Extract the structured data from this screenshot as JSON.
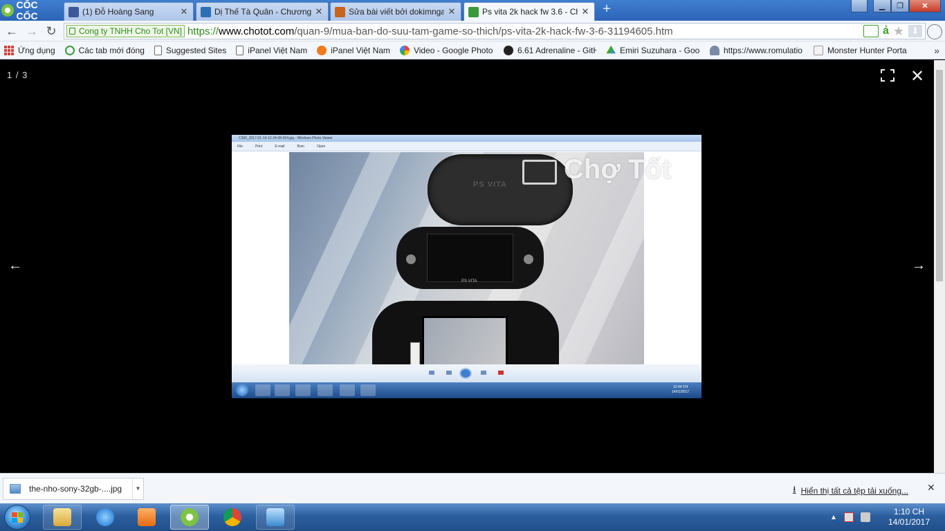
{
  "browser": {
    "brand": "CỐC CỐC",
    "tabs": [
      {
        "label": "(1) Đỗ Hoàng Sang",
        "icon": "facebook-icon",
        "color": "#3b5998"
      },
      {
        "label": "Dị Thế Tà Quân - Chương",
        "icon": "book-icon",
        "color": "#2d6fb5"
      },
      {
        "label": "Sửa bài viết bởi dokimnga",
        "icon": "forum-icon",
        "color": "#c8641e"
      },
      {
        "label": "Ps vita 2k hack fw 3.6 - Ch",
        "icon": "chotot-icon",
        "color": "#3a9a3a"
      }
    ],
    "address": {
      "ev_label": "Cong ty TNHH Cho Tot [VN]",
      "scheme": "https://",
      "host": "www.chotot.com",
      "path": "/quan-9/mua-ban-do-suu-tam-game-so-thich/ps-vita-2k-hack-fw-3-6-31194605.htm"
    },
    "omnibox_a": "ả",
    "bookmarks": [
      {
        "label": "Ứng dụng",
        "icon": "apps-icon"
      },
      {
        "label": "Các tab mới đóng",
        "icon": "recent-tabs-icon"
      },
      {
        "label": "Suggested Sites",
        "icon": "page-icon"
      },
      {
        "label": "iPanel Việt Nam",
        "icon": "page-icon"
      },
      {
        "label": "iPanel Việt Nam",
        "icon": "ipanel-icon"
      },
      {
        "label": "Video - Google Photo",
        "icon": "google-photos-icon"
      },
      {
        "label": "6.61 Adrenaline - GitH",
        "icon": "github-icon"
      },
      {
        "label": "Emiri Suzuhara - Goog",
        "icon": "google-drive-icon"
      },
      {
        "label": "https://www.romulatio",
        "icon": "romulation-icon"
      },
      {
        "label": "Monster Hunter Porta",
        "icon": "ps-icon"
      }
    ]
  },
  "viewer": {
    "counter": "1 / 3",
    "fullscreen_icon": "fullscreen-icon",
    "close_icon": "close-icon",
    "prev_arrow": "←",
    "next_arrow": "→",
    "close_glyph": "✕",
    "photo": {
      "window_title": "C360_2017-01-14-12-24-08-934.jpg - Windows Photo Viewer",
      "menu": [
        "File",
        "Print",
        "E-mail",
        "Burn",
        "Open"
      ],
      "case_logo": "PS VITA",
      "device_logo": "PS VITA",
      "watermark": "Chợ Tốt",
      "inner_clock_time": "12:44 CH",
      "inner_clock_date": "14/01/2017"
    }
  },
  "downloads": {
    "file_name": "the-nho-sony-32gb-....jpg",
    "show_all": "Hiển thị tất cả tệp tải xuống..."
  },
  "taskbar": {
    "apps": [
      "explorer",
      "internet-explorer",
      "media-player",
      "coccoc",
      "chrome",
      "photo-viewer"
    ],
    "time": "1:10 CH",
    "date": "14/01/2017"
  }
}
